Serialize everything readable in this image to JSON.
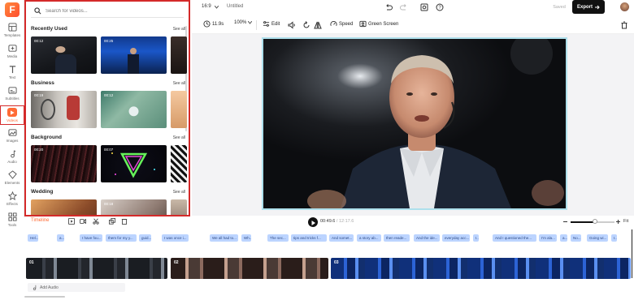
{
  "app": {
    "logo": "F",
    "aspect": "16:9",
    "doc_title": "Untitled",
    "saved": "Saved",
    "export": "Export"
  },
  "rail": {
    "items": [
      {
        "label": "Templates",
        "icon": "templates-icon"
      },
      {
        "label": "Media",
        "icon": "media-icon"
      },
      {
        "label": "Text",
        "icon": "text-icon"
      },
      {
        "label": "Subtitles",
        "icon": "subtitles-icon"
      },
      {
        "label": "Videos",
        "icon": "videos-icon"
      },
      {
        "label": "Images",
        "icon": "images-icon"
      },
      {
        "label": "Audio",
        "icon": "audio-icon"
      },
      {
        "label": "Elements",
        "icon": "elements-icon"
      },
      {
        "label": "Effects",
        "icon": "effects-icon"
      },
      {
        "label": "Tools",
        "icon": "tools-icon"
      }
    ],
    "active": "Videos"
  },
  "panel": {
    "search_placeholder": "Search for videos...",
    "see_all": "See all",
    "sections": [
      {
        "title": "Recently Used",
        "durations": [
          "00:12",
          "00:25",
          ""
        ]
      },
      {
        "title": "Business",
        "durations": [
          "00:19",
          "00:12",
          ""
        ]
      },
      {
        "title": "Background",
        "durations": [
          "00:20",
          "00:07",
          ""
        ]
      },
      {
        "title": "Wedding",
        "durations": [
          "",
          "00:18",
          ""
        ]
      }
    ]
  },
  "toolbar": {
    "duration": "11.9s",
    "zoom": "100%",
    "edit": "Edit",
    "speed": "Speed",
    "green_screen": "Green Screen"
  },
  "timeline": {
    "label": "Timeline",
    "current": "00:49.6",
    "total": "12:17.6",
    "fit": "Fit",
    "subtitles": [
      "Hel...",
      "a...",
      "I have fou...",
      "them for my y...",
      "guid...",
      "I was once i...",
      "We all had to...",
      "Wh...",
      "The sec...",
      "tips and tricks f...",
      "And somet...",
      "a story ab...",
      "then reade...",
      "And the ide...",
      "everyday acc...",
      "I...",
      "And I questioned the...",
      "I'm ala...",
      "a...",
      "No...",
      "Going wi...",
      "I..."
    ],
    "clips": [
      {
        "num": "01"
      },
      {
        "num": "02"
      },
      {
        "num": "03"
      }
    ],
    "add_audio": "Add Audio"
  }
}
